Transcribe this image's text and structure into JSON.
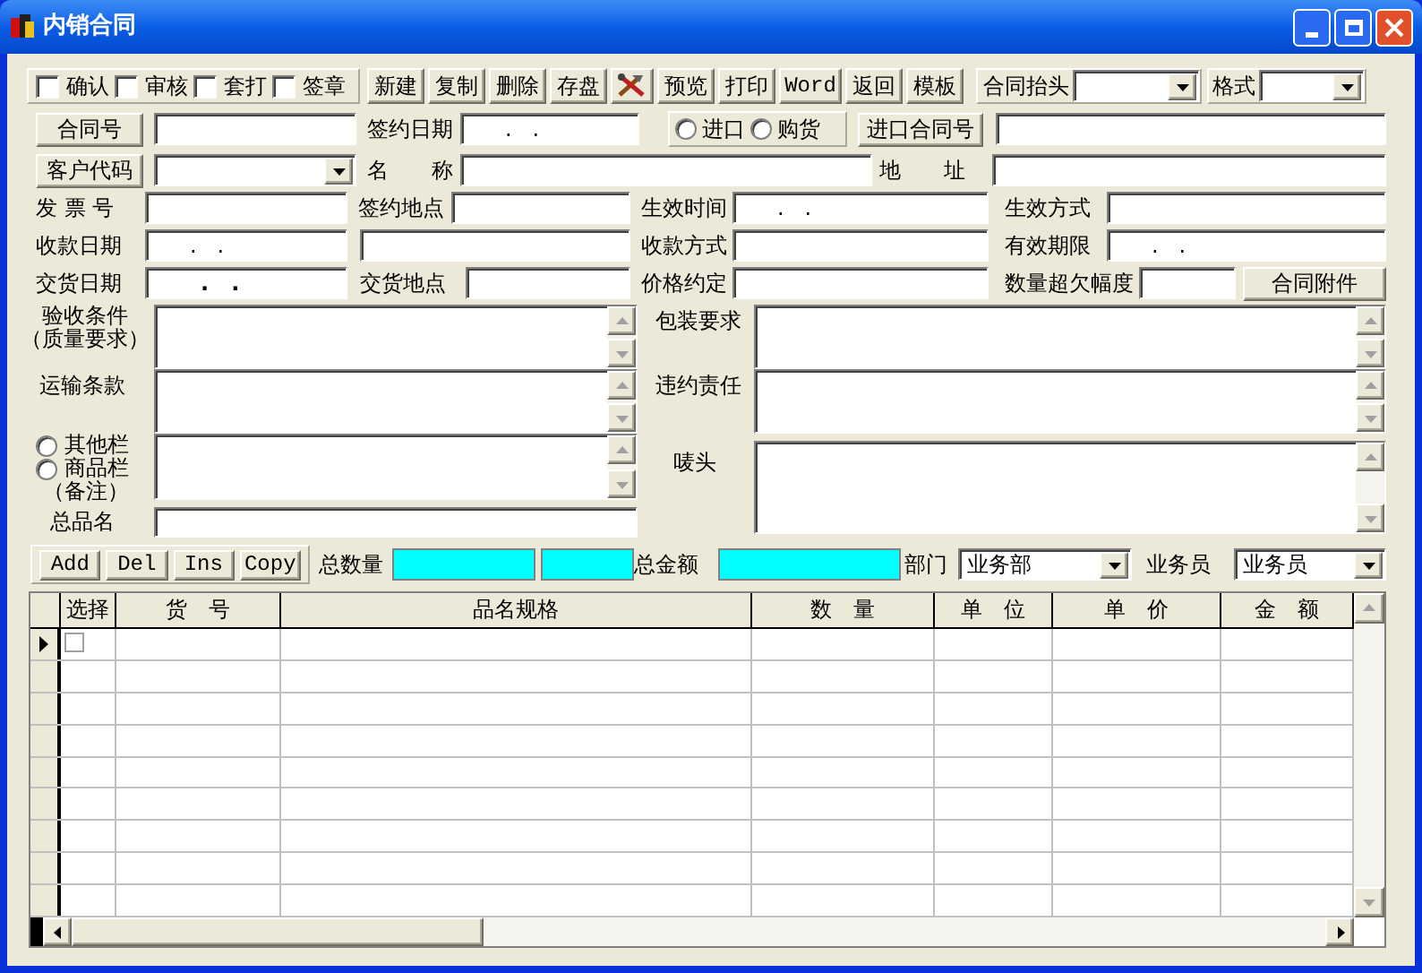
{
  "window": {
    "title": "内销合同"
  },
  "checkboxes": [
    {
      "label": "确认",
      "checked": false
    },
    {
      "label": "审核",
      "checked": false
    },
    {
      "label": "套打",
      "checked": false
    },
    {
      "label": "签章",
      "checked": false
    }
  ],
  "toolbar": [
    {
      "kind": "text",
      "label": "新建"
    },
    {
      "kind": "text",
      "label": "复制"
    },
    {
      "kind": "text",
      "label": "删除"
    },
    {
      "kind": "text",
      "label": "存盘"
    },
    {
      "kind": "icon"
    },
    {
      "kind": "text",
      "label": "预览"
    },
    {
      "kind": "text",
      "label": "打印"
    },
    {
      "kind": "mono",
      "label": "Word"
    },
    {
      "kind": "text",
      "label": "返回"
    },
    {
      "kind": "text",
      "label": "模板"
    }
  ],
  "contract_header": {
    "label": "合同抬头"
  },
  "format": {
    "label": "格式"
  },
  "form": {
    "contract_no": {
      "label": "合同号"
    },
    "sign_date": {
      "label": "签约日期",
      "value": ".   ."
    },
    "trade_type": [
      {
        "label": "进口",
        "selected": false
      },
      {
        "label": "购货",
        "selected": false
      }
    ],
    "import_contract_no": {
      "label": "进口合同号"
    },
    "customer_code": {
      "label": "客户代码"
    },
    "name": {
      "label": "名　　称"
    },
    "address": {
      "label": "地　　址"
    },
    "invoice_no": {
      "label": "发 票 号"
    },
    "sign_place": {
      "label": "签约地点"
    },
    "effective_time": {
      "label": "生效时间",
      "value": ".   ."
    },
    "effective_mode": {
      "label": "生效方式"
    },
    "payment_date": {
      "label": "收款日期",
      "value": ".   ."
    },
    "payment_method": {
      "label": "收款方式"
    },
    "validity": {
      "label": "有效期限",
      "value": ".   ."
    },
    "delivery_date": {
      "label": "交货日期",
      "value": ".   ."
    },
    "delivery_place": {
      "label": "交货地点"
    },
    "price_terms": {
      "label": "价格约定"
    },
    "quantity_tolerance": {
      "label": "数量超欠幅度"
    },
    "attachment": {
      "label": "合同附件"
    },
    "acceptance": {
      "label_lines": [
        "验收条件",
        "（质量要求）"
      ]
    },
    "transport": {
      "label": "运输条款"
    },
    "remark_radios": [
      {
        "label": "其他栏",
        "selected": false
      },
      {
        "label": "商品栏",
        "selected": false
      }
    ],
    "remark_note": "（备注）",
    "total_name": {
      "label": "总品名"
    },
    "packaging": {
      "label": "包装要求"
    },
    "liability": {
      "label": "违约责任"
    },
    "marks": {
      "label": "唛头"
    }
  },
  "row_buttons": [
    "Add",
    "Del",
    "Ins",
    "Copy"
  ],
  "totals": {
    "quantity_label": "总数量",
    "amount_label": "总金额"
  },
  "department": {
    "label": "部门",
    "value": "业务部"
  },
  "salesman": {
    "label": "业务员",
    "value": "业务员"
  },
  "grid": {
    "columns": [
      "选择",
      "货　号",
      "品名规格",
      "数　量",
      "单　位",
      "单　价",
      "金　额"
    ],
    "rows": [
      {
        "current": true,
        "checked": false
      }
    ]
  }
}
